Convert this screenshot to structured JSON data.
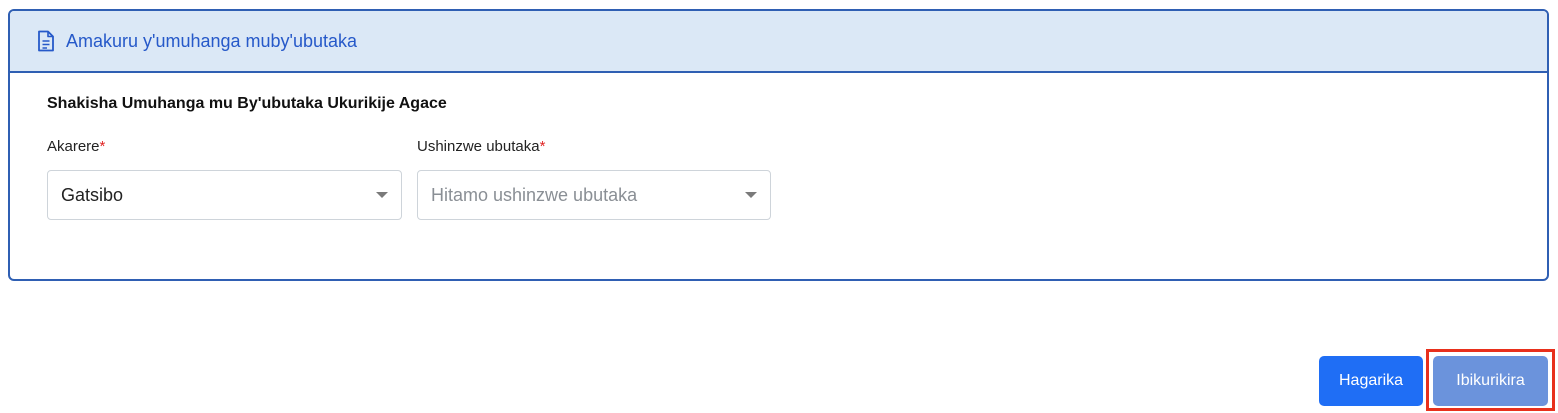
{
  "card": {
    "header_title": "Amakuru y'umuhanga muby'ubutaka",
    "header_icon": "document-icon",
    "section_title": "Shakisha Umuhanga mu By'ubutaka Ukurikije Agace"
  },
  "fields": {
    "district": {
      "label": "Akarere",
      "required": "*",
      "value": "Gatsibo"
    },
    "surveyor": {
      "label": "Ushinzwe ubutaka",
      "required": "*",
      "placeholder": "Hitamo ushinzwe ubutaka"
    }
  },
  "actions": {
    "cancel_label": "Hagarika",
    "next_label": "Ibikurikira"
  },
  "colors": {
    "header_bg": "#dbe8f6",
    "border": "#2f5fb3",
    "title": "#2659c9",
    "primary_button": "#1f6ef5",
    "disabled_button": "#6b93dc",
    "highlight": "#e8301c"
  }
}
